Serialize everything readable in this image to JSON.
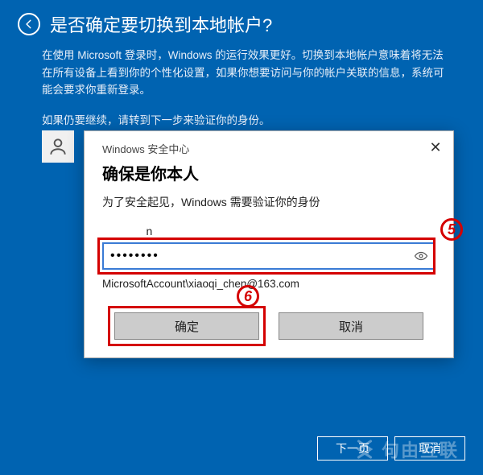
{
  "header": {
    "title": "是否确定要切换到本地帐户?"
  },
  "description": {
    "p1": "在使用 Microsoft 登录时，Windows 的运行效果更好。切换到本地帐户意味着将无法在所有设备上看到你的个性化设置，如果你想要访问与你的帐户关联的信息，系统可能会要求你重新登录。",
    "p2": "如果仍要继续，请转到下一步来验证你的身份。"
  },
  "dialog": {
    "caption": "Windows 安全中心",
    "title": "确保是你本人",
    "subtitle": "为了安全起见，Windows 需要验证你的身份",
    "username_display": "              n",
    "password_value": "••••••••",
    "account_line": "MicrosoftAccount\\xiaoqi_chen@163.com",
    "ok_label": "确定",
    "cancel_label": "取消",
    "close_label": "✕"
  },
  "annotations": {
    "marker5": "5",
    "marker6": "6"
  },
  "footer": {
    "next_label": "下一页",
    "cancel_label": "取消"
  },
  "watermark": {
    "text": "句由互联"
  }
}
